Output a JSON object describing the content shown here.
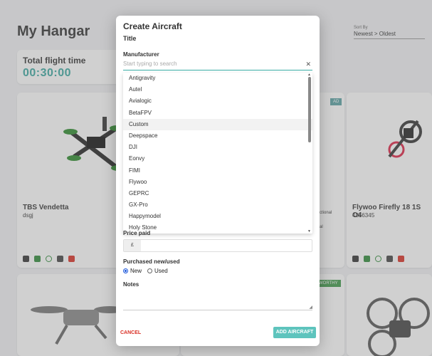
{
  "page": {
    "title": "My Hangar",
    "sort_label": "Sort By",
    "sort_value": "Newest > Oldest",
    "flight_card": {
      "title": "Total flight time",
      "value": "00:30:00"
    }
  },
  "cards": [
    {
      "name": "TBS Vendetta",
      "id": "dsgj"
    },
    {
      "name": "Flywoo Firefly 18 1S O4",
      "id": "4356345"
    }
  ],
  "card_badges": {
    "ad": "AD",
    "worthy": "WORTHY",
    "partial_text": "ctional",
    "partial_text2": "al"
  },
  "modal": {
    "title": "Create Aircraft",
    "title_label": "Title",
    "manufacturer_label": "Manufacturer",
    "search_placeholder": "Start typing to search",
    "manufacturers": [
      "Antigravity",
      "Autel",
      "Avialogic",
      "BetaFPV",
      "Custom",
      "Deepspace",
      "DJI",
      "Eonvy",
      "FIMI",
      "Flywoo",
      "GEPRC",
      "GX-Pro",
      "Happymodel",
      "Holy Stone"
    ],
    "highlighted_index": 4,
    "price_label": "Price paid",
    "currency_symbol": "£",
    "purchased_label": "Purchased new/used",
    "option_new": "New",
    "option_used": "Used",
    "notes_label": "Notes",
    "cancel_label": "CANCEL",
    "add_label": "ADD AIRCRAFT"
  },
  "colors": {
    "accent": "#3aaea6",
    "add_button": "#5ec4bd",
    "cancel": "#d93025",
    "badge": "#5aa2a4",
    "worthy_badge": "#3f9a4a"
  }
}
